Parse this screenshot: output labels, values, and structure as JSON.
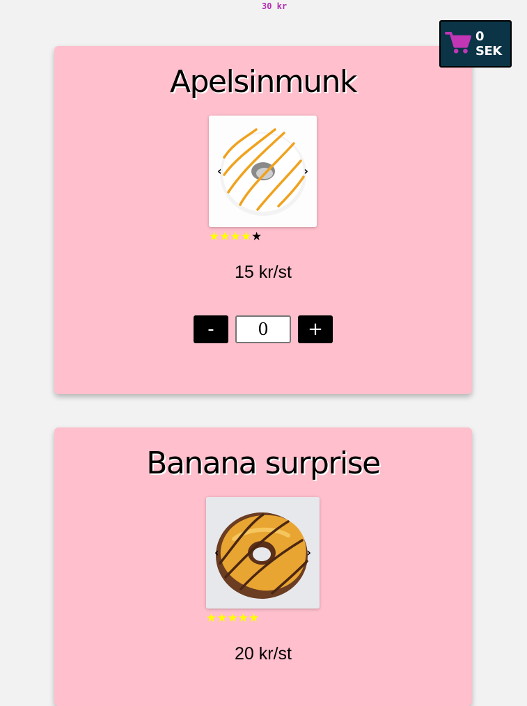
{
  "top_price": "30 kr",
  "cart": {
    "total": "0 SEK",
    "icon": "shopping-cart-icon",
    "icon_color": "#c236b6",
    "bg_color": "#0b3447"
  },
  "products": [
    {
      "name": "Apelsinmunk",
      "image": "orange-glazed-donut",
      "rating": 4,
      "rating_max": 5,
      "price": "15 kr/st",
      "quantity": "0",
      "minus_label": "-",
      "plus_label": "+",
      "prev_arrow": "‹",
      "next_arrow": "›"
    },
    {
      "name": "Banana surprise",
      "image": "banana-chocolate-donut",
      "rating": 5,
      "rating_max": 5,
      "price": "20 kr/st",
      "prev_arrow": "‹",
      "next_arrow": "›"
    }
  ],
  "colors": {
    "page_bg": "#f2f2f2",
    "card_bg": "#ffbfcc",
    "star_on": "#ffff00",
    "star_off": "#000000",
    "accent": "#b12fb1"
  }
}
